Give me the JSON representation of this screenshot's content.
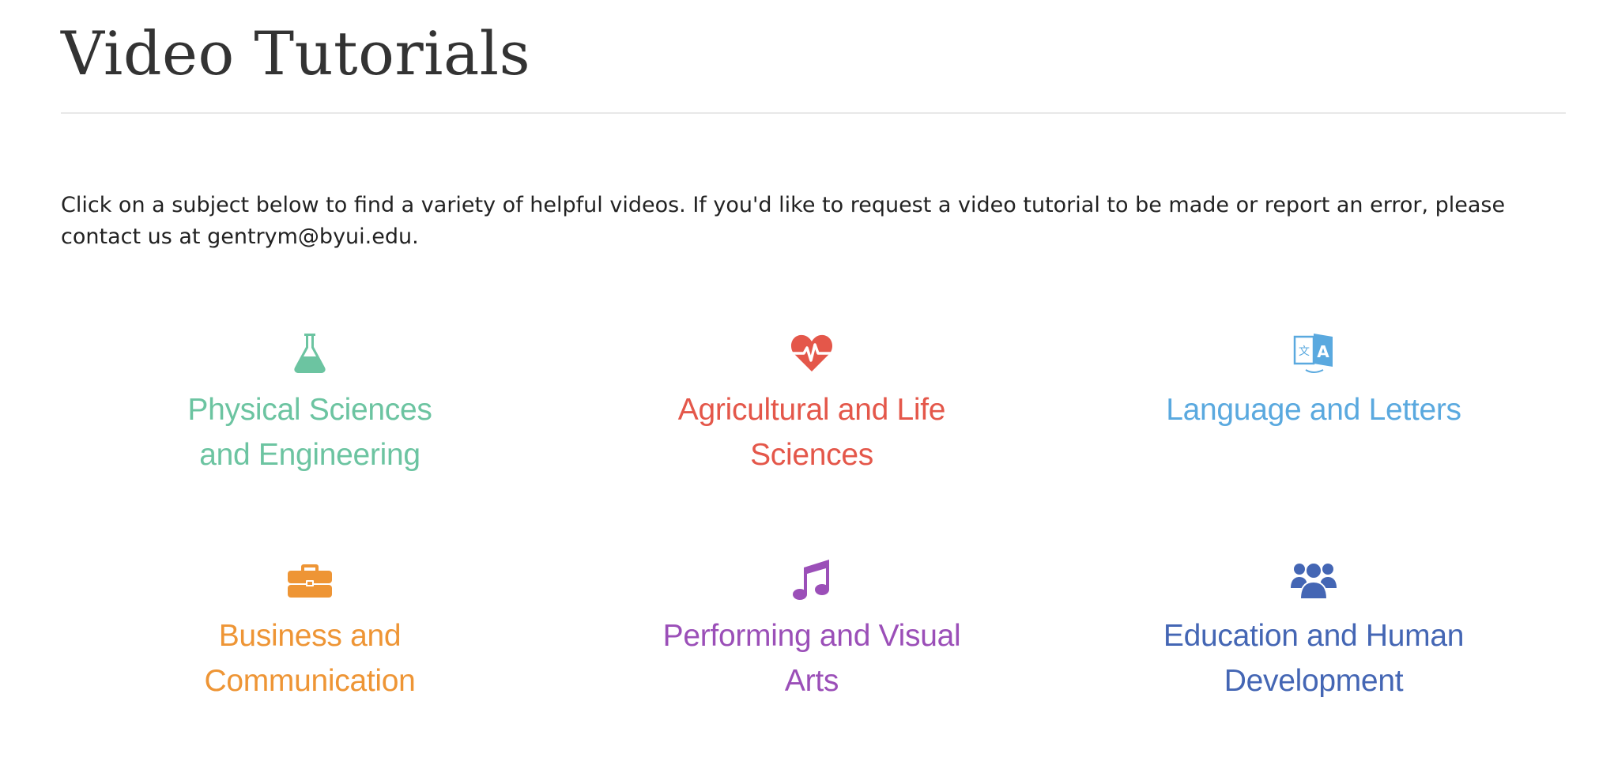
{
  "page": {
    "title": "Video Tutorials",
    "intro_line1": "Click on a subject below to find a variety of helpful videos. If you'd like to request a video tutorial to be made or report an error, please",
    "intro_line2": "contact us at gentrym@byui.edu."
  },
  "subjects": [
    {
      "label_line1": "Physical Sciences",
      "label_line2": "and Engineering",
      "icon": "flask-icon",
      "color": "#6cc4a1"
    },
    {
      "label_line1": "Agricultural and Life",
      "label_line2": "Sciences",
      "icon": "heartbeat-icon",
      "color": "#e4574a"
    },
    {
      "label_line1": "Language and Letters",
      "label_line2": "",
      "icon": "translate-icon",
      "color": "#5aa9df"
    },
    {
      "label_line1": "Business and",
      "label_line2": "Communication",
      "icon": "briefcase-icon",
      "color": "#ee9535"
    },
    {
      "label_line1": "Performing and Visual",
      "label_line2": "Arts",
      "icon": "music-note-icon",
      "color": "#9b4fb8"
    },
    {
      "label_line1": "Education and Human",
      "label_line2": "Development",
      "icon": "users-icon",
      "color": "#4466b4"
    }
  ]
}
